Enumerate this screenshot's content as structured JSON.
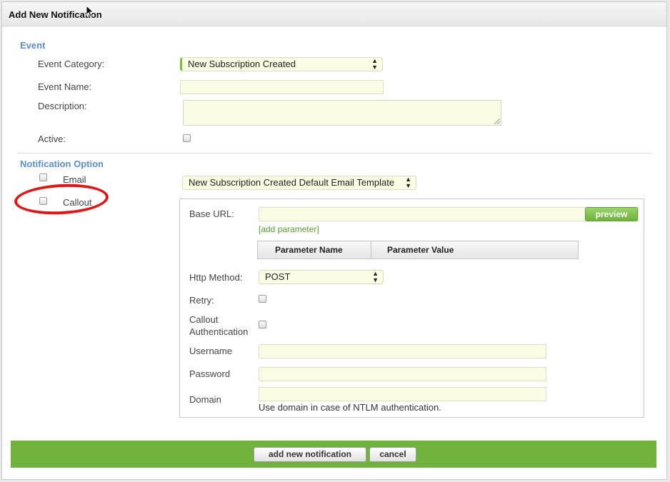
{
  "dialog": {
    "title": "Add New Notification"
  },
  "event": {
    "heading": "Event",
    "category_label": "Event Category:",
    "category_value": "New Subscription Created",
    "name_label": "Event Name:",
    "name_value": "",
    "description_label": "Description:",
    "description_value": "",
    "active_label": "Active:"
  },
  "notification": {
    "heading": "Notification Option",
    "email_label": "Email",
    "callout_label": "Callout",
    "email_template_value": "New Subscription Created Default Email Template"
  },
  "callout": {
    "base_url_label": "Base URL:",
    "base_url_value": "",
    "preview_label": "preview",
    "add_parameter_link": "[add parameter]",
    "param_name_header": "Parameter Name",
    "param_value_header": "Parameter Value",
    "http_method_label": "Http Method:",
    "http_method_value": "POST",
    "retry_label": "Retry:",
    "auth_label_line1": "Callout",
    "auth_label_line2": "Authentication",
    "username_label": "Username",
    "password_label": "Password",
    "domain_label": "Domain",
    "domain_hint": "Use domain in case of NTLM authentication."
  },
  "footer": {
    "add_label": "add new notification",
    "cancel_label": "cancel"
  },
  "colors": {
    "accent_green": "#6fb23c",
    "section_blue": "#5b8fc9",
    "input_bg": "#fbfce4",
    "highlight_red": "#e01515"
  }
}
